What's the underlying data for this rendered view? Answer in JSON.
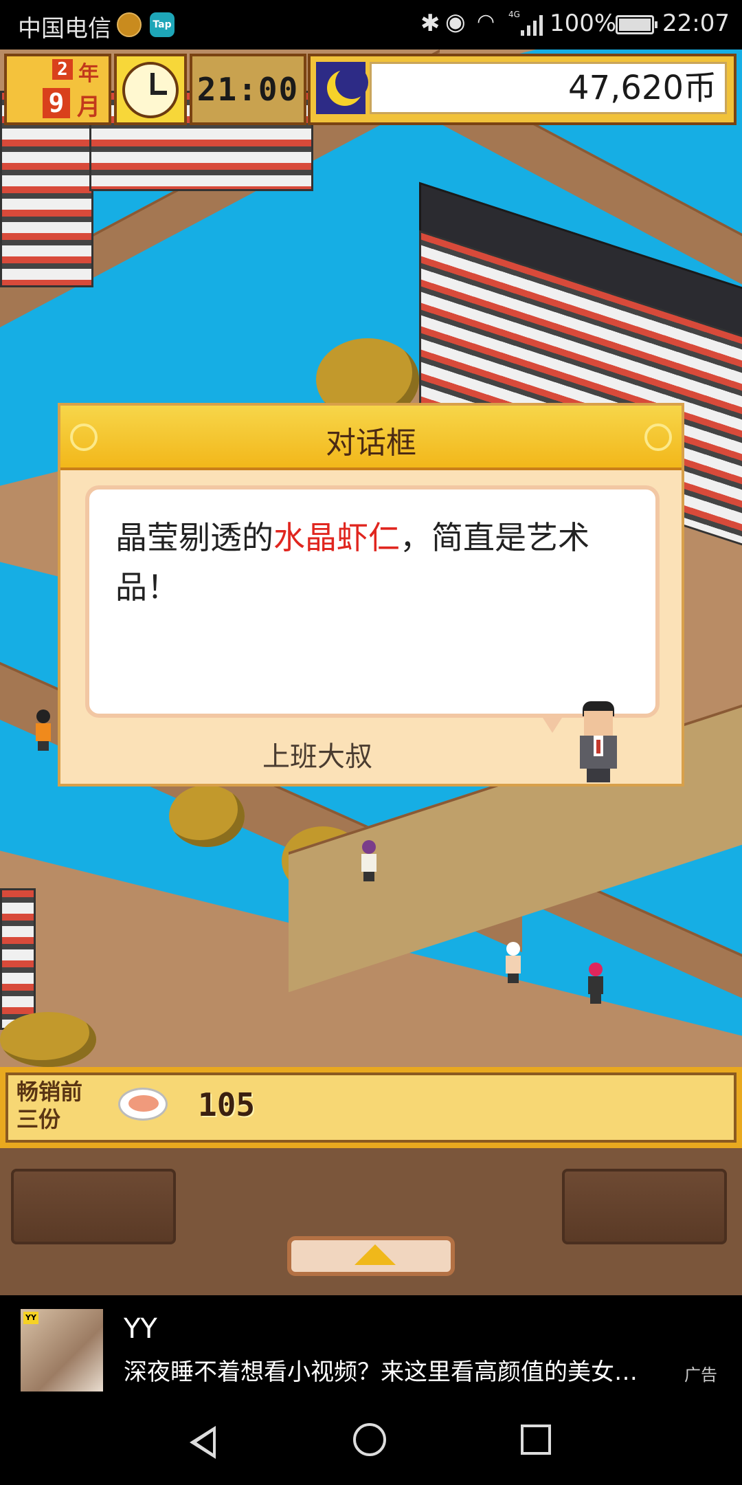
{
  "status_bar": {
    "carrier": "中国电信",
    "app_badge": "Tap",
    "signal_label": "4G",
    "battery": "100%",
    "time": "22:07"
  },
  "hud": {
    "year_num": "2",
    "year_label": "年",
    "month_num": "9",
    "month_label": "月",
    "game_time": "21:00",
    "money": "47,620币"
  },
  "dialog": {
    "title": "对话框",
    "message_before": "晶莹剔透的",
    "message_highlight": "水晶虾仁",
    "message_after": "，简直是艺术品！",
    "speaker": "上班大叔"
  },
  "bestseller": {
    "label": "畅销前三份",
    "count": "105"
  },
  "ad": {
    "badge": "YY",
    "name": "YY",
    "description": "深夜睡不着想看小视频？来这里看高颜值的美女…",
    "tag": "广告"
  },
  "colors": {
    "water": "#16aee4",
    "deck": "#a47752",
    "gold": "#f1c23a",
    "highlight": "#e0261f"
  }
}
